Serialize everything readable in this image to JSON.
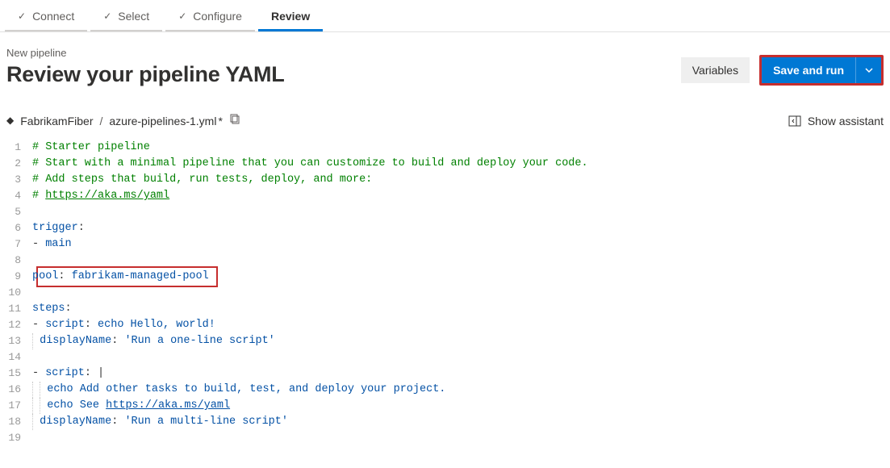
{
  "tabs": {
    "connect": "Connect",
    "select": "Select",
    "configure": "Configure",
    "review": "Review"
  },
  "header": {
    "subtitle": "New pipeline",
    "title": "Review your pipeline YAML",
    "variables_label": "Variables",
    "save_and_run_label": "Save and run"
  },
  "breadcrumb": {
    "repo": "FabrikamFiber",
    "filename": "azure-pipelines-1.yml",
    "dirty_indicator": "*"
  },
  "assistant": {
    "label": "Show assistant"
  },
  "code": {
    "l1": "# Starter pipeline",
    "l2": "# Start with a minimal pipeline that you can customize to build and deploy your code.",
    "l3": "# Add steps that build, run tests, deploy, and more:",
    "l4_prefix": "# ",
    "l4_link": "https://aka.ms/yaml",
    "l6_key": "trigger",
    "l7_item": "main",
    "l9_key": "pool",
    "l9_value": "fabrikam-managed-pool",
    "l11_key": "steps",
    "l12_key": "script",
    "l12_value": "echo Hello, world!",
    "l13_key": "displayName",
    "l13_value": "'Run a one-line script'",
    "l15_key": "script",
    "l16_text": "echo Add other tasks to build, test, and deploy your project.",
    "l17_prefix": "echo See ",
    "l17_link": "https://aka.ms/yaml",
    "l18_key": "displayName",
    "l18_value": "'Run a multi-line script'"
  },
  "line_numbers": [
    "1",
    "2",
    "3",
    "4",
    "5",
    "6",
    "7",
    "8",
    "9",
    "10",
    "11",
    "12",
    "13",
    "14",
    "15",
    "16",
    "17",
    "18",
    "19"
  ]
}
